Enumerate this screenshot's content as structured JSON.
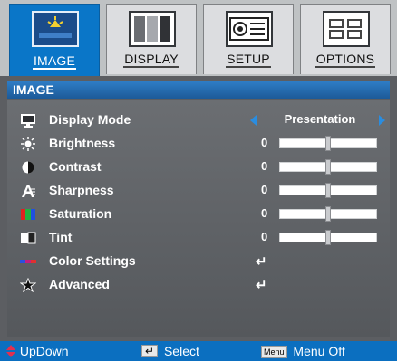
{
  "tabs": [
    {
      "label": "IMAGE",
      "icon": "image-tab-icon",
      "active": true
    },
    {
      "label": "DISPLAY",
      "icon": "display-tab-icon",
      "active": false
    },
    {
      "label": "SETUP",
      "icon": "setup-tab-icon",
      "active": false
    },
    {
      "label": "OPTIONS",
      "icon": "options-tab-icon",
      "active": false
    }
  ],
  "section_title": "IMAGE",
  "items": [
    {
      "label": "Display Mode",
      "value": "Presentation",
      "icon": "monitor-icon"
    },
    {
      "label": "Brightness",
      "value": "0",
      "icon": "sun-icon",
      "slider": 0.5
    },
    {
      "label": "Contrast",
      "value": "0",
      "icon": "contrast-icon",
      "slider": 0.5
    },
    {
      "label": "Sharpness",
      "value": "0",
      "icon": "sharpness-icon",
      "slider": 0.5
    },
    {
      "label": "Saturation",
      "value": "0",
      "icon": "saturation-icon",
      "slider": 0.5
    },
    {
      "label": "Tint",
      "value": "0",
      "icon": "tint-icon",
      "slider": 0.5
    },
    {
      "label": "Color Settings",
      "value": "↵",
      "icon": "color-settings-icon"
    },
    {
      "label": "Advanced",
      "value": "↵",
      "icon": "advanced-icon"
    }
  ],
  "footer": {
    "updown": "UpDown",
    "select": "Select",
    "menu_key": "Menu",
    "menu_off": "Menu Off"
  },
  "colors": {
    "accent": "#0a76c8",
    "panel": "#5c5e62"
  }
}
